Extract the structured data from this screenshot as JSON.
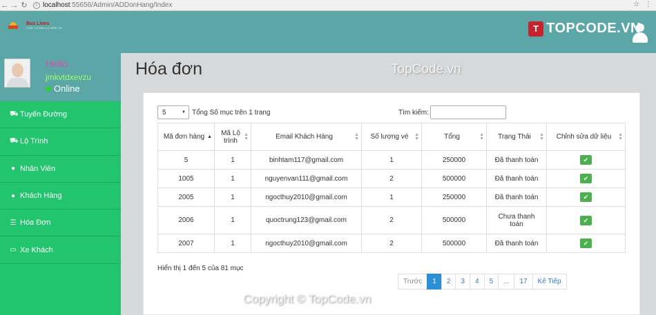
{
  "browser": {
    "url_host": "localhost",
    "url_path": ":55656/Admin/ADDonHang/Index"
  },
  "watermark": {
    "brand_badge": "T",
    "brand": "TOPCODE.VN",
    "center": "TopCode.vn",
    "copyright": "Copyright © TopCode.vn"
  },
  "logo": {
    "text": "Bus Lines",
    "sub": "CHẤT LƯỢNG LÀ NIỀM TIN"
  },
  "profile": {
    "hello": "Hello",
    "username": "jmkvtdxevzu",
    "status": "Online"
  },
  "sidebar": {
    "items": [
      {
        "label": "Tuyến Đường",
        "icon": "road-icon"
      },
      {
        "label": "Lộ Trình",
        "icon": "route-icon"
      },
      {
        "label": "Nhân Viên",
        "icon": "user-icon"
      },
      {
        "label": "Khách Hàng",
        "icon": "user-icon"
      },
      {
        "label": "Hóa Đơn",
        "icon": "list-icon"
      },
      {
        "label": "Xe Khách",
        "icon": "card-icon"
      }
    ]
  },
  "page": {
    "title": "Hóa đơn"
  },
  "table_controls": {
    "page_size": "5",
    "page_size_label": "Tổng Số mục trên 1 trang",
    "search_label": "Tìm kiếm:",
    "search_value": ""
  },
  "table": {
    "headers": [
      "Mã đơn hàng",
      "Mã Lộ trình",
      "Email Khách Hàng",
      "Số lượng vé",
      "Tổng",
      "Trạng Thái",
      "Chỉnh sửa dữ liệu"
    ],
    "rows": [
      [
        "5",
        "1",
        "binhtam117@gmail.com",
        "1",
        "250000",
        "Đã thanh toán"
      ],
      [
        "1005",
        "1",
        "nguyenvan111@gmail.com",
        "2",
        "500000",
        "Đã thanh toán"
      ],
      [
        "2005",
        "1",
        "ngocthuy2010@gmail.com",
        "1",
        "250000",
        "Đã thanh toán"
      ],
      [
        "2006",
        "1",
        "quoctrung123@gmail.com",
        "2",
        "500000",
        "Chưa thanh toán"
      ],
      [
        "2007",
        "1",
        "ngocthuy2010@gmail.com",
        "2",
        "500000",
        "Đã thanh toán"
      ]
    ],
    "edit_icon": "✔"
  },
  "footer": {
    "info": "Hiển thị 1 đến 5 của 81 mục",
    "pagination": [
      "Trước",
      "1",
      "2",
      "3",
      "4",
      "5",
      "...",
      "17",
      "Kế Tiếp"
    ],
    "active_page": "1"
  },
  "colors": {
    "header": "#5ba7a7",
    "sidebar": "#22c46e",
    "active_page": "#2a8fd6",
    "edit_button": "#4caf50"
  }
}
